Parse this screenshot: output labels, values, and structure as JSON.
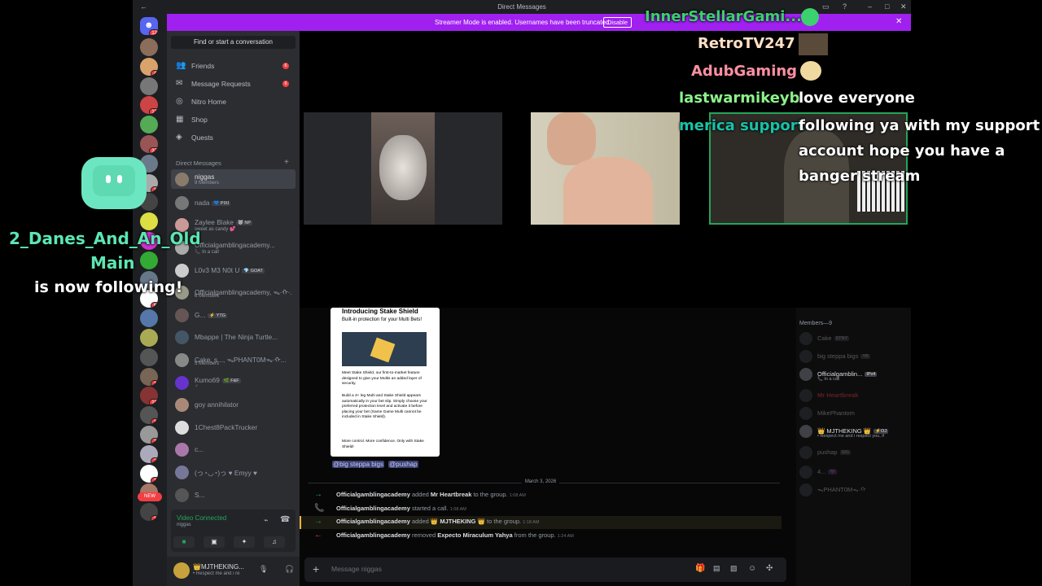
{
  "window": {
    "title": "Direct Messages",
    "back_glyph": "←"
  },
  "banner": {
    "text": "Streamer Mode is enabled. Usernames have been truncated.",
    "button": "Disable",
    "close": "✕"
  },
  "servers": {
    "home_badge": "12",
    "badges": [
      "",
      "4",
      "",
      "12",
      "",
      "37",
      "",
      "1",
      "",
      "",
      "",
      "",
      "",
      "6",
      "",
      "",
      "",
      "1",
      "10",
      "1",
      "3",
      "2",
      "1",
      "4",
      "1"
    ],
    "new_label": "NEW"
  },
  "sidebar": {
    "find": "Find or start a conversation",
    "nav": [
      {
        "icon": "friends-icon",
        "label": "Friends",
        "badge": "6"
      },
      {
        "icon": "inbox-icon",
        "label": "Message Requests",
        "badge": "6"
      },
      {
        "icon": "nitro-icon",
        "label": "Nitro Home",
        "badge": ""
      },
      {
        "icon": "shop-icon",
        "label": "Shop",
        "badge": ""
      },
      {
        "icon": "quests-icon",
        "label": "Quests",
        "badge": ""
      }
    ],
    "dm_header": "Direct Messages",
    "dm_plus": "+",
    "dms": [
      {
        "name": "niggas",
        "sub": "9 Members",
        "tag": "",
        "selected": true
      },
      {
        "name": "nada",
        "sub": "",
        "tag": "💙 PIXI"
      },
      {
        "name": "Zaylee Blake",
        "sub": "sweet as candy 💕",
        "tag": "🐺 NP"
      },
      {
        "name": "Officialgamblingacademy...",
        "sub": "📞 In a call",
        "tag": ""
      },
      {
        "name": "L0v3 M3 N0t U",
        "sub": "",
        "tag": "💎 GOAT"
      },
      {
        "name": "Officialgamblingacademy, ᯓ·ᡣ·...",
        "sub": "6 Members",
        "tag": ""
      },
      {
        "name": "G...",
        "sub": "",
        "tag": "⚡ YTG"
      },
      {
        "name": "Mbappe | The Ninja Turtle...",
        "sub": "",
        "tag": ""
      },
      {
        "name": "Cake, s..., ᯓPHANT0Mᯓ·ᡣ...",
        "sub": "5 Members",
        "tag": ""
      },
      {
        "name": "Kumo69",
        "sub": "♂",
        "tag": "🌿 F&F"
      },
      {
        "name": "goy annihilator",
        "sub": "",
        "tag": ""
      },
      {
        "name": "1Chest8PackTrucker",
        "sub": "",
        "tag": ""
      },
      {
        "name": "c...",
        "sub": "",
        "tag": ""
      },
      {
        "name": "(っ◔◡◔)っ ♥ Emyy ♥",
        "sub": "",
        "tag": ""
      },
      {
        "name": "S...",
        "sub": "",
        "tag": ""
      }
    ],
    "voice": {
      "status": "Video Connected",
      "channel": "niggas"
    },
    "user": {
      "name": "👑MJTHEKING...",
      "status": "• Respect me and i re"
    }
  },
  "stream_overlay": {
    "follow_user": "2_Danes_And_An_Old",
    "follow_user2": "Main",
    "follow_text": "is now following!",
    "chat": [
      {
        "user": "InnerStellarGami...",
        "color": "#3bd16f",
        "msg": ""
      },
      {
        "user": "RetroTV247",
        "color": "#ffe0c4",
        "msg": ""
      },
      {
        "user": "AdubGaming",
        "color": "#ff8fa3",
        "msg": ""
      },
      {
        "user": "lastwarmikeyb",
        "color": "#8df28a",
        "msg": "love everyone"
      },
      {
        "user": "merica support",
        "color": "#17c3a8",
        "msg": "following ya with my support"
      },
      {
        "user": "",
        "color": "",
        "msg": "account hope you have a"
      },
      {
        "user": "",
        "color": "",
        "msg": "banger stream"
      }
    ]
  },
  "chat": {
    "promo": {
      "title": "Introducing Stake Shield",
      "subtitle": "Built-in protection for your Multi Bets!",
      "p1": "Meet Stake Shield, our first-to-market feature designed to give your Multis an added layer of security.",
      "p2": "Build a 3+ leg Multi and Stake Shield appears automatically in your bet slip. Simply choose your preferred protection level and activate it before placing your bet (Same Game Multi cannot be included in Stake Shield).",
      "p3": "More control. More confidence. Only with Stake Shield!"
    },
    "mentions": [
      "@big steppa bigs",
      "@pushap"
    ],
    "date": "March 3, 2026",
    "events": [
      {
        "arrow": "→",
        "color": "#23a55a",
        "actor": "Officialgamblingacademy",
        "verb": "added",
        "target": "Mr Heartbreak",
        "tail": "to the group.",
        "time": "1:08 AM"
      },
      {
        "arrow": "📞",
        "color": "#23a55a",
        "actor": "Officialgamblingacademy",
        "verb": "started a call.",
        "target": "",
        "tail": "",
        "time": "1:08 AM"
      },
      {
        "arrow": "→",
        "color": "#23a55a",
        "actor": "Officialgamblingacademy",
        "verb": "added",
        "target": "👑 MJTHEKING 👑",
        "tail": "to the group.",
        "time": "1:18 AM"
      },
      {
        "arrow": "←",
        "color": "#f23f43",
        "actor": "Officialgamblingacademy",
        "verb": "removed",
        "target": "Expecto Miraculum Yahya",
        "tail": "from the group.",
        "time": "1:24 AM"
      }
    ],
    "input_placeholder": "Message niggas"
  },
  "members": {
    "header": "Members—9",
    "list": [
      {
        "name": "Cake",
        "tag": "STNY",
        "faded": true
      },
      {
        "name": "big steppa bigs",
        "tag": "YB",
        "faded": true
      },
      {
        "name": "Officialgamblin...",
        "tag": "IPv4",
        "sub": "📞 In a call",
        "faded": false
      },
      {
        "name": "Mr Heartbreak",
        "tag": "",
        "faded": true
      },
      {
        "name": "MikePhantom",
        "tag": "",
        "faded": true
      },
      {
        "name": "👑 MJTHEKING 👑",
        "tag": "⚡OJ",
        "sub": "• Respect me and i respect you, if",
        "faded": false
      },
      {
        "name": "pushap",
        "tag": "SIG",
        "faded": true
      },
      {
        "name": "4...",
        "tag": "💜",
        "faded": true
      },
      {
        "name": "ᯓPHANT0Mᯓ·ᡣ",
        "tag": "",
        "faded": true
      }
    ]
  },
  "colors": {
    "accent": "#a020f0",
    "blurple": "#5865f2",
    "green": "#23a55a",
    "red": "#f23f43",
    "twitch_mint": "#5ce6b2"
  }
}
